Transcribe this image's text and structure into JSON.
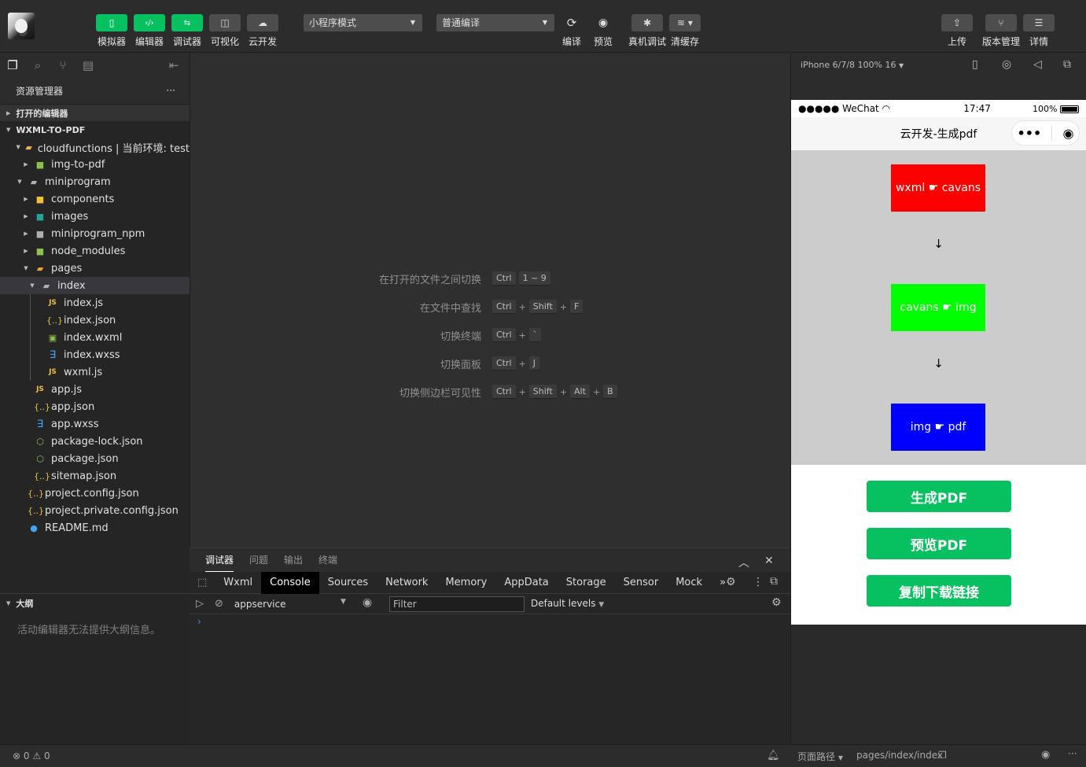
{
  "toolbar": {
    "simulator": "模拟器",
    "editor": "编辑器",
    "debugger": "调试器",
    "visual": "可视化",
    "cloud": "云开发",
    "mode_select": "小程序模式",
    "compile_select": "普通编译",
    "compile": "编译",
    "preview": "预览",
    "device_debug": "真机调试",
    "clear_cache": "清缓存",
    "upload": "上传",
    "version": "版本管理",
    "details": "详情"
  },
  "sidebar": {
    "title": "资源管理器",
    "more": "···",
    "open_editors": "打开的编辑器",
    "project": "WXML-TO-PDF",
    "tree": [
      {
        "name": "cloudfunctions | 当前环境: test"
      },
      {
        "name": "img-to-pdf"
      },
      {
        "name": "miniprogram"
      },
      {
        "name": "components"
      },
      {
        "name": "images"
      },
      {
        "name": "miniprogram_npm"
      },
      {
        "name": "node_modules"
      },
      {
        "name": "pages"
      },
      {
        "name": "index"
      },
      {
        "name": "index.js"
      },
      {
        "name": "index.json"
      },
      {
        "name": "index.wxml"
      },
      {
        "name": "index.wxss"
      },
      {
        "name": "wxml.js"
      },
      {
        "name": "app.js"
      },
      {
        "name": "app.json"
      },
      {
        "name": "app.wxss"
      },
      {
        "name": "package-lock.json"
      },
      {
        "name": "package.json"
      },
      {
        "name": "sitemap.json"
      },
      {
        "name": "project.config.json"
      },
      {
        "name": "project.private.config.json"
      },
      {
        "name": "README.md"
      }
    ],
    "outline": "大纲",
    "outline_msg": "活动编辑器无法提供大纲信息。"
  },
  "shortcuts": [
    {
      "label": "在打开的文件之间切换",
      "keys": [
        "Ctrl",
        "1 ~ 9"
      ]
    },
    {
      "label": "在文件中查找",
      "keys": [
        "Ctrl",
        "Shift",
        "F"
      ]
    },
    {
      "label": "切换终端",
      "keys": [
        "Ctrl",
        "`"
      ]
    },
    {
      "label": "切换面板",
      "keys": [
        "Ctrl",
        "J"
      ]
    },
    {
      "label": "切换侧边栏可见性",
      "keys": [
        "Ctrl",
        "Shift",
        "Alt",
        "B"
      ]
    }
  ],
  "debug": {
    "tabs": [
      "调试器",
      "问题",
      "输出",
      "终端"
    ],
    "devtools": [
      "Wxml",
      "Console",
      "Sources",
      "Network",
      "Memory",
      "AppData",
      "Storage",
      "Sensor",
      "Mock"
    ],
    "more": "»",
    "context": "appservice",
    "filter": "Filter",
    "levels": "Default levels",
    "prompt": "›"
  },
  "simulator": {
    "device": "iPhone 6/7/8 100% 16",
    "carrier": "●●●●● WeChat",
    "time": "17:47",
    "battery": "100%",
    "page_title": "云开发-生成pdf",
    "capsule_more": "•••",
    "blocks": [
      {
        "text": "wxml ☛ cavans",
        "color": "#ff0000"
      },
      {
        "text": "cavans ☛ img",
        "color": "#00ff00"
      },
      {
        "text": "img ☛ pdf",
        "color": "#0000ff"
      }
    ],
    "arrow": "↓",
    "buttons": [
      "生成PDF",
      "预览PDF",
      "复制下载链接"
    ]
  },
  "status": {
    "errors": "0",
    "warnings": "0",
    "page_path_label": "页面路径",
    "page_path": "pages/index/index",
    "more": "···"
  }
}
